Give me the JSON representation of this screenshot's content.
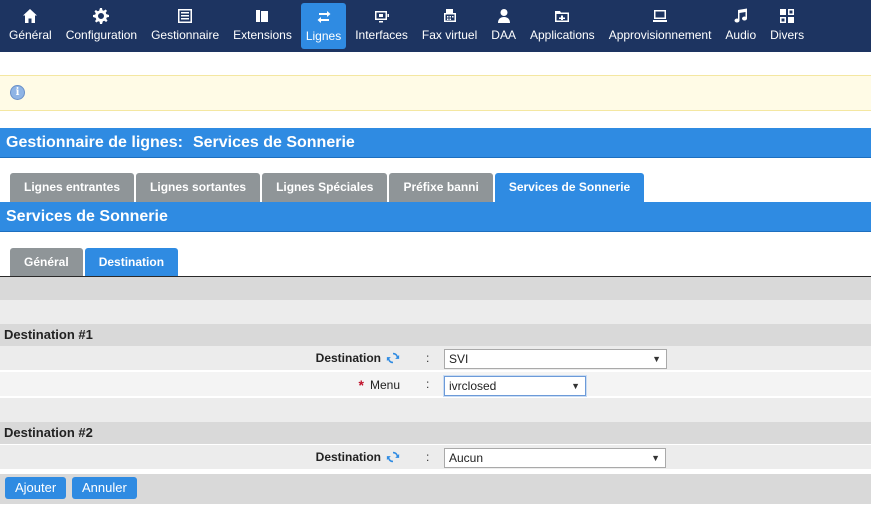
{
  "nav": [
    {
      "label": "Général",
      "icon": "home-icon"
    },
    {
      "label": "Configuration",
      "icon": "gear-icon"
    },
    {
      "label": "Gestionnaire",
      "icon": "list-icon"
    },
    {
      "label": "Extensions",
      "icon": "phone-icon"
    },
    {
      "label": "Lignes",
      "icon": "lines-icon",
      "active": true
    },
    {
      "label": "Interfaces",
      "icon": "interface-icon"
    },
    {
      "label": "Fax virtuel",
      "icon": "fax-icon"
    },
    {
      "label": "DAA",
      "icon": "user-icon"
    },
    {
      "label": "Applications",
      "icon": "applications-icon"
    },
    {
      "label": "Approvisionnement",
      "icon": "provisioning-icon"
    },
    {
      "label": "Audio",
      "icon": "music-icon"
    },
    {
      "label": "Divers",
      "icon": "misc-icon"
    }
  ],
  "page": {
    "title_prefix": "Gestionnaire de lignes:",
    "title_main": "Services de Sonnerie",
    "section_title": "Services de Sonnerie"
  },
  "tabs": [
    {
      "label": "Lignes entrantes"
    },
    {
      "label": "Lignes sortantes"
    },
    {
      "label": "Lignes Spéciales"
    },
    {
      "label": "Préfixe banni"
    },
    {
      "label": "Services de Sonnerie",
      "active": true
    }
  ],
  "subtabs": [
    {
      "label": "Général"
    },
    {
      "label": "Destination",
      "active": true
    }
  ],
  "dest1": {
    "heading": "Destination #1",
    "destination_label": "Destination",
    "destination_value": "SVI",
    "menu_required_mark": "*",
    "menu_label": "Menu",
    "menu_value": "ivrclosed",
    "colon": ":"
  },
  "dest2": {
    "heading": "Destination #2",
    "destination_label": "Destination",
    "destination_value": "Aucun",
    "colon": ":"
  },
  "buttons": {
    "add": "Ajouter",
    "cancel": "Annuler"
  },
  "colors": {
    "nav_bg": "#1d3461",
    "accent": "#2f8be2",
    "tab_inactive": "#8f9598",
    "info_bg": "#fffbe6"
  }
}
